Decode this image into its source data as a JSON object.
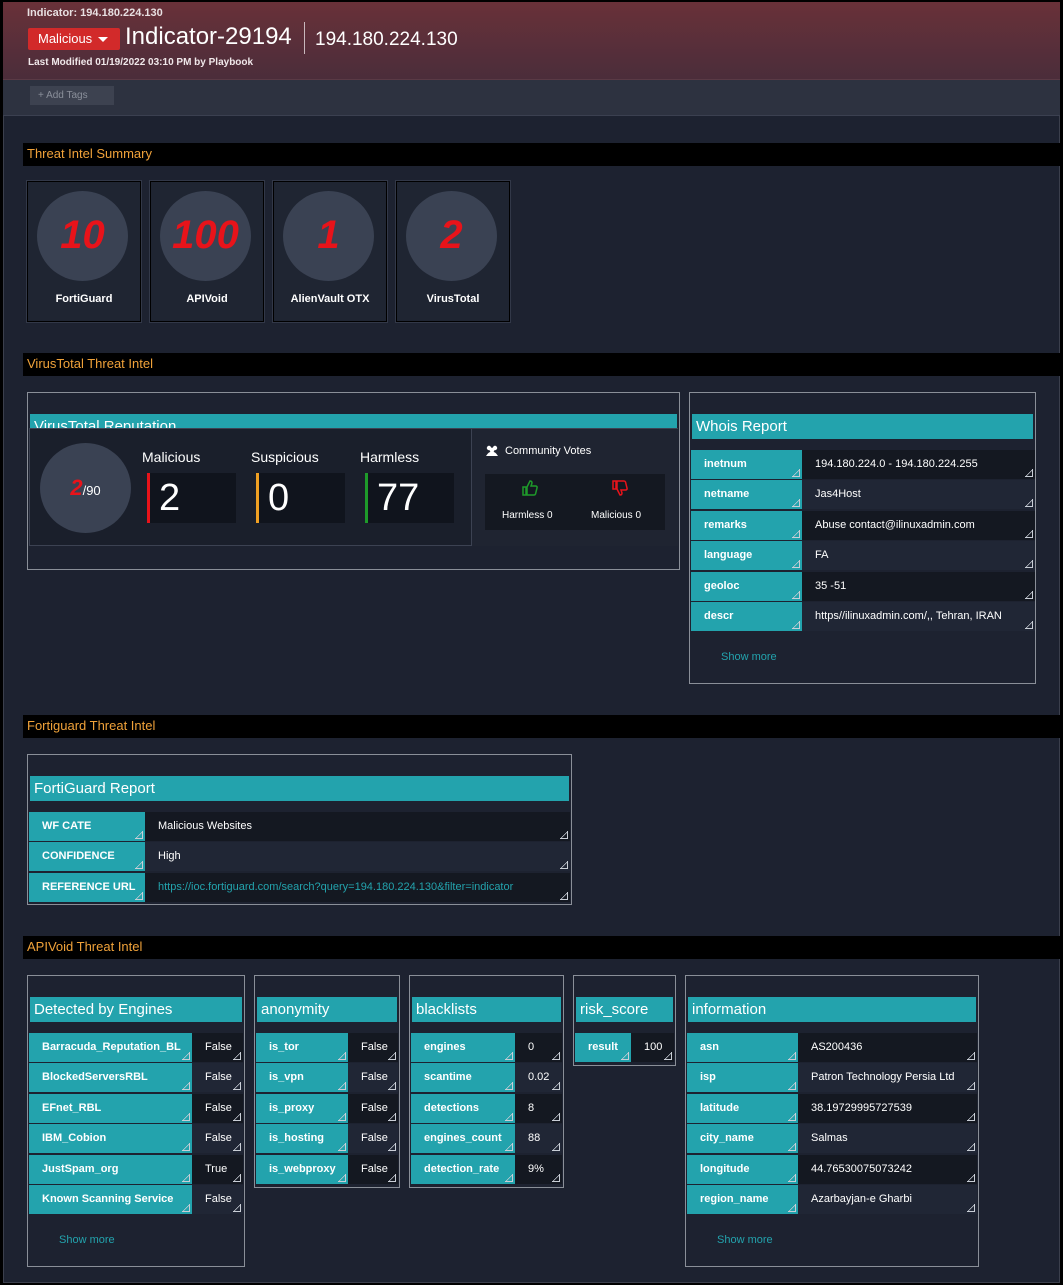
{
  "header": {
    "breadcrumb": "Indicator: 194.180.224.130",
    "severity": "Malicious",
    "indicator_id": "Indicator-29194",
    "indicator_value": "194.180.224.130",
    "modified": "Last Modified 01/19/2022 03:10 PM by Playbook"
  },
  "tags": {
    "add_label": "+ Add Tags"
  },
  "sections": {
    "summary": "Threat Intel Summary",
    "virustotal": "VirusTotal Threat Intel",
    "fortiguard": "Fortiguard Threat Intel",
    "apivoid": "APIVoid Threat Intel"
  },
  "summary_cards": [
    {
      "value": "10",
      "label": "FortiGuard"
    },
    {
      "value": "100",
      "label": "APIVoid"
    },
    {
      "value": "1",
      "label": "AlienVault OTX"
    },
    {
      "value": "2",
      "label": "VirusTotal"
    }
  ],
  "vt_reputation": {
    "title": "VirusTotal Reputation",
    "score": "2",
    "total": "/90",
    "malicious_label": "Malicious",
    "malicious": "2",
    "suspicious_label": "Suspicious",
    "suspicious": "0",
    "harmless_label": "Harmless",
    "harmless": "77",
    "community_title": "Community Votes",
    "harmless_votes": "Harmless 0",
    "malicious_votes": "Malicious 0",
    "colors": {
      "malicious": "#e8131a",
      "suspicious": "#f0a023",
      "harmless": "#1e9a2a"
    }
  },
  "whois": {
    "title": "Whois Report",
    "rows": [
      {
        "key": "inetnum",
        "value": "194.180.224.0 - 194.180.224.255"
      },
      {
        "key": "netname",
        "value": "Jas4Host"
      },
      {
        "key": "remarks",
        "value": "Abuse contact@ilinuxadmin.com"
      },
      {
        "key": "language",
        "value": "FA"
      },
      {
        "key": "geoloc",
        "value": "35 -51"
      },
      {
        "key": "descr",
        "value": "https//ilinuxadmin.com/,, Tehran, IRAN"
      }
    ],
    "show_more": "Show more"
  },
  "fortiguard": {
    "title": "FortiGuard Report",
    "rows": [
      {
        "key": "WF CATE",
        "value": "Malicious Websites"
      },
      {
        "key": "CONFIDENCE",
        "value": "High"
      },
      {
        "key": "REFERENCE URL",
        "value": "https://ioc.fortiguard.com/search?query=194.180.224.130&filter=indicator"
      }
    ]
  },
  "apivoid": {
    "engines": {
      "title": "Detected by Engines",
      "rows": [
        {
          "key": "Barracuda_Reputation_BL",
          "value": "False"
        },
        {
          "key": "BlockedServersRBL",
          "value": "False"
        },
        {
          "key": "EFnet_RBL",
          "value": "False"
        },
        {
          "key": "IBM_Cobion",
          "value": "False"
        },
        {
          "key": "JustSpam_org",
          "value": "True"
        },
        {
          "key": "Known Scanning Service",
          "value": "False"
        }
      ],
      "show_more": "Show more"
    },
    "anonymity": {
      "title": "anonymity",
      "rows": [
        {
          "key": "is_tor",
          "value": "False"
        },
        {
          "key": "is_vpn",
          "value": "False"
        },
        {
          "key": "is_proxy",
          "value": "False"
        },
        {
          "key": "is_hosting",
          "value": "False"
        },
        {
          "key": "is_webproxy",
          "value": "False"
        }
      ]
    },
    "blacklists": {
      "title": "blacklists",
      "rows": [
        {
          "key": "engines",
          "value": "0"
        },
        {
          "key": "scantime",
          "value": "0.02"
        },
        {
          "key": "detections",
          "value": "8"
        },
        {
          "key": "engines_count",
          "value": "88"
        },
        {
          "key": "detection_rate",
          "value": "9%"
        }
      ]
    },
    "risk_score": {
      "title": "risk_score",
      "rows": [
        {
          "key": "result",
          "value": "100"
        }
      ]
    },
    "information": {
      "title": "information",
      "rows": [
        {
          "key": "asn",
          "value": "AS200436"
        },
        {
          "key": "isp",
          "value": "Patron Technology Persia Ltd"
        },
        {
          "key": "latitude",
          "value": "38.19729995727539"
        },
        {
          "key": "city_name",
          "value": "Salmas"
        },
        {
          "key": "longitude",
          "value": "44.76530075073242"
        },
        {
          "key": "region_name",
          "value": "Azarbayjan-e Gharbi"
        }
      ],
      "show_more": "Show more"
    }
  }
}
